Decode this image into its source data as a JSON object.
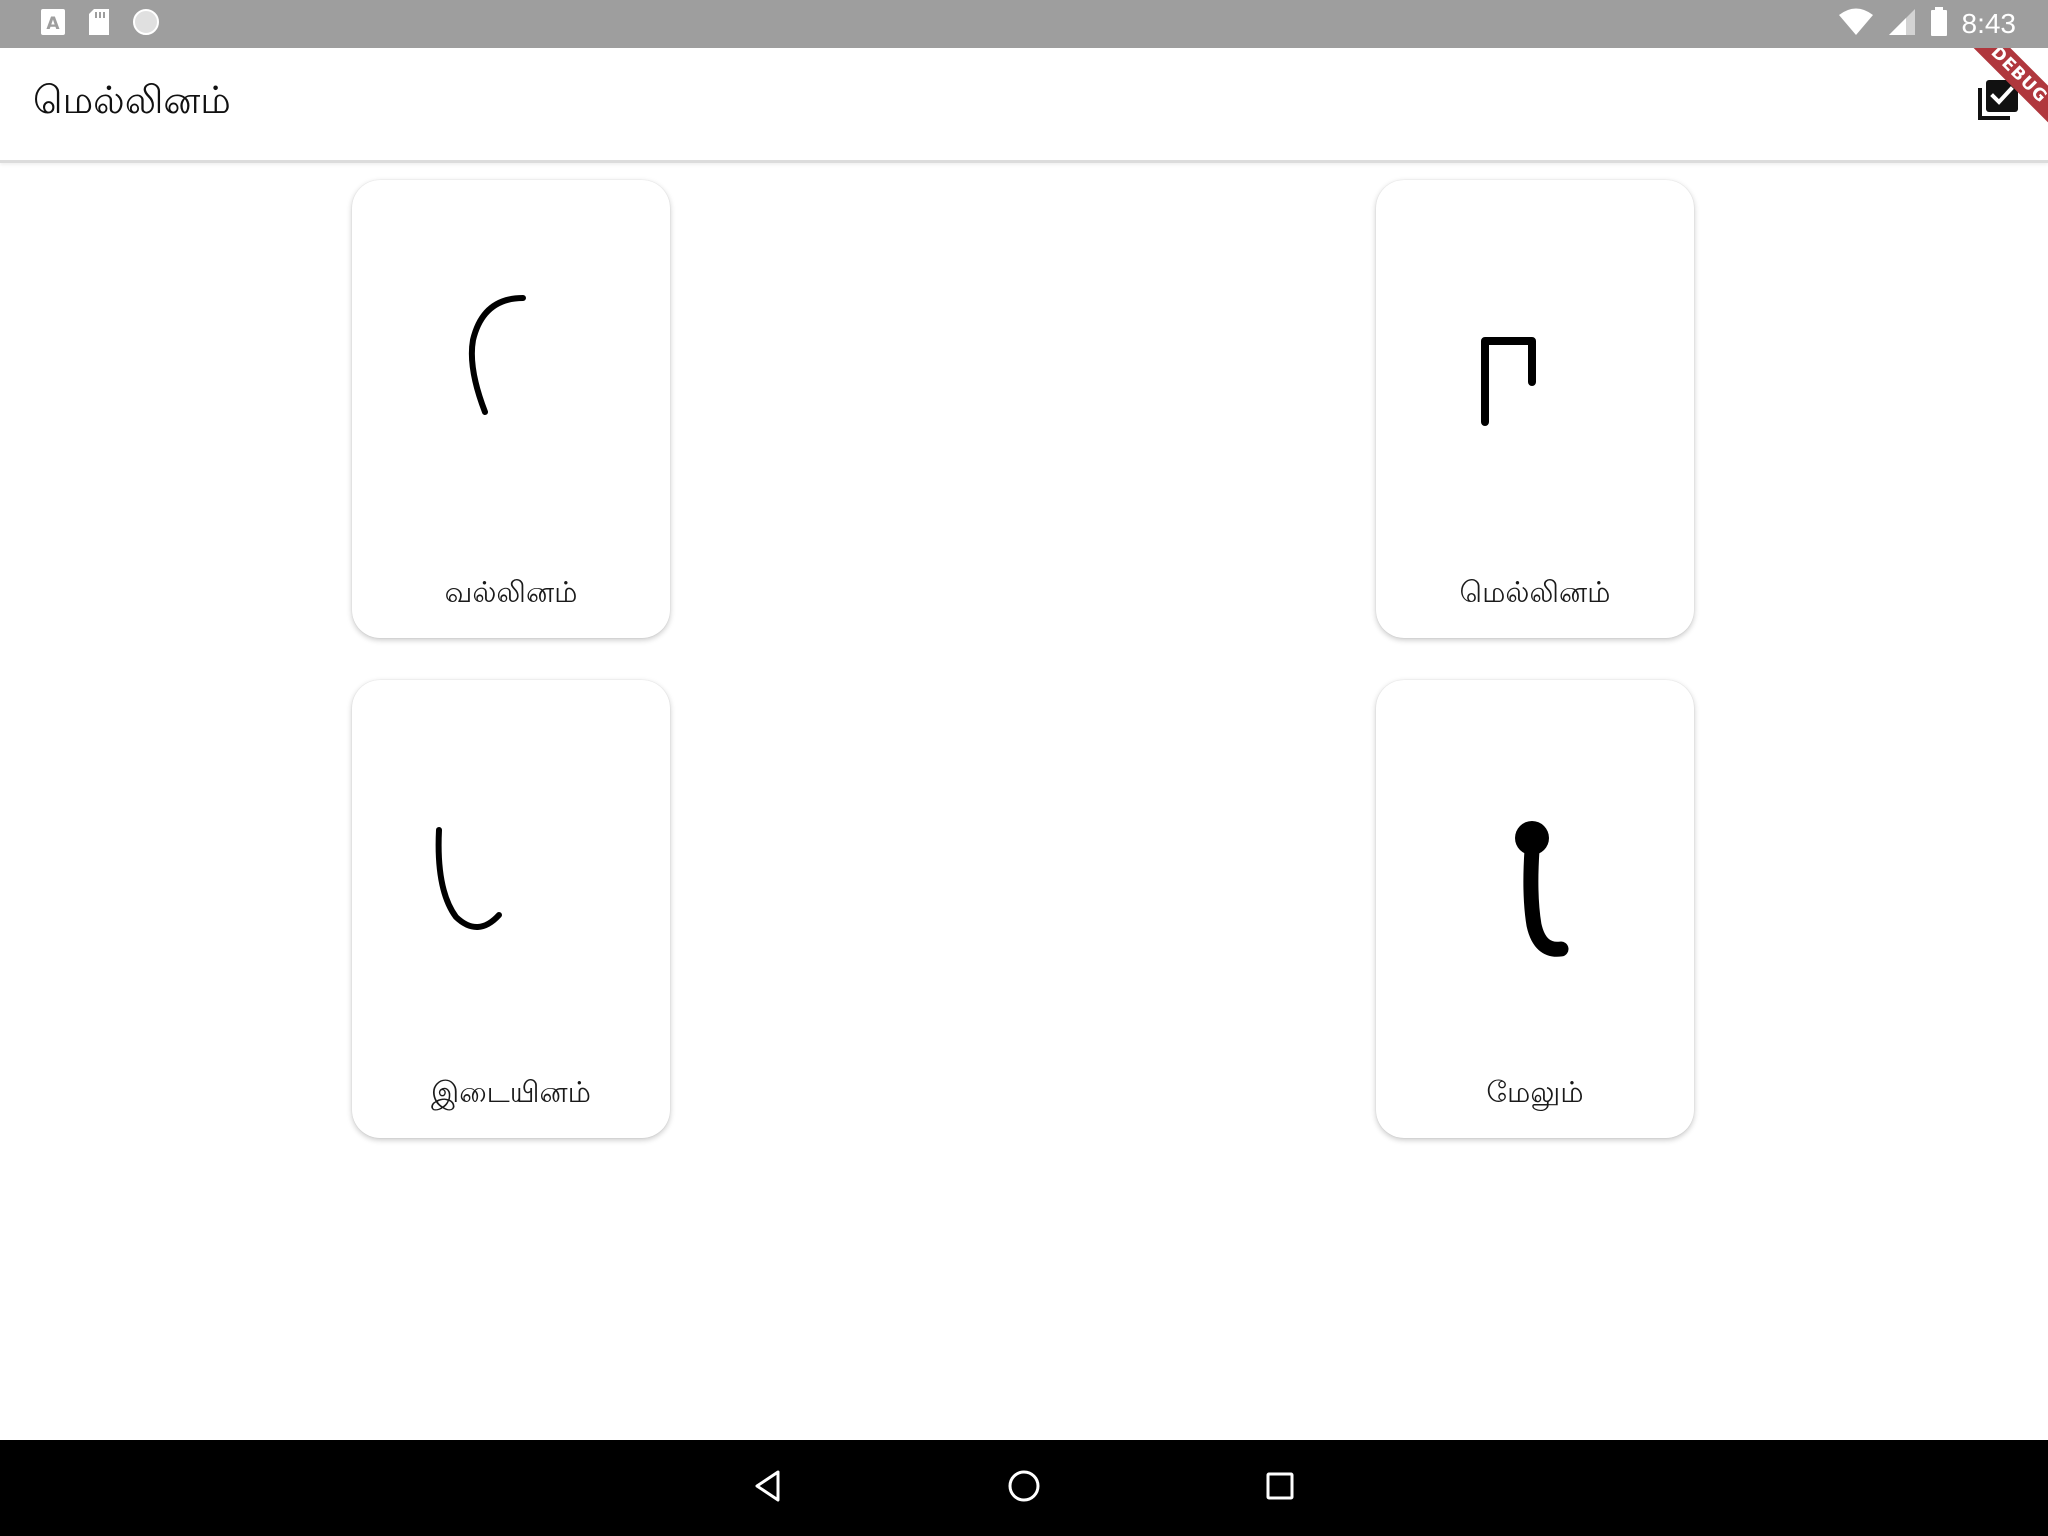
{
  "status_bar": {
    "time": "8:43",
    "left_icons": [
      "font-download-icon",
      "sd-card-icon",
      "circle-icon"
    ],
    "right_icons": [
      "wifi-icon",
      "cellular-signal-icon",
      "battery-icon"
    ]
  },
  "app_bar": {
    "title": "மெல்லினம்",
    "action_icon": "library-add-check-icon",
    "debug_banner": "DEBUG"
  },
  "cards": [
    {
      "label": "வல்லினம்",
      "icon": "vallinam-stroke-icon"
    },
    {
      "label": "மெல்லினம்",
      "icon": "mellinam-stroke-icon"
    },
    {
      "label": "இடையினம்",
      "icon": "idaiyinam-stroke-icon"
    },
    {
      "label": "மேலும்",
      "icon": "melum-stroke-icon"
    }
  ],
  "nav_bar": {
    "buttons": [
      "back-icon",
      "home-icon",
      "recents-icon"
    ]
  },
  "colors": {
    "status_bar": "#9e9e9e",
    "app_bar": "#ffffff",
    "debug_ribbon": "#b0373d",
    "nav_bar": "#000000"
  }
}
